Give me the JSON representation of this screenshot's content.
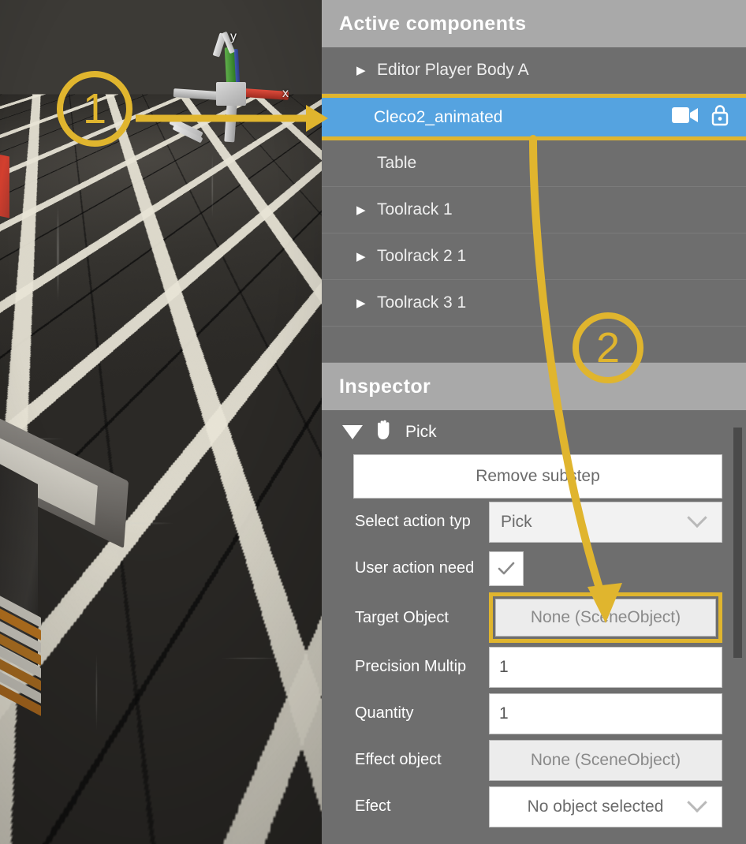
{
  "accent_color": "#e0b52e",
  "selection_color": "#55a3e0",
  "panel_bg": "#6e6e6e",
  "header_bg": "#a9a9a9",
  "viewport": {
    "name": "scene-viewport",
    "gizmo": {
      "x_label": "x",
      "y_label": "y"
    }
  },
  "hierarchy": {
    "title": "Active components",
    "rows": [
      {
        "label": "Editor Player Body A",
        "expandable": true,
        "selected": false,
        "icons": []
      },
      {
        "label": "Cleco2_animated",
        "expandable": false,
        "selected": true,
        "icons": [
          "camera-icon",
          "unlock-icon"
        ]
      },
      {
        "label": "Table",
        "expandable": false,
        "selected": false,
        "icons": []
      },
      {
        "label": "Toolrack 1",
        "expandable": true,
        "selected": false,
        "icons": []
      },
      {
        "label": "Toolrack 2 1",
        "expandable": true,
        "selected": false,
        "icons": []
      },
      {
        "label": "Toolrack 3 1",
        "expandable": true,
        "selected": false,
        "icons": []
      }
    ]
  },
  "inspector": {
    "title": "Inspector",
    "component": {
      "icon": "hand-icon",
      "name": "Pick",
      "expanded": true
    },
    "remove_button": "Remove substep",
    "fields": [
      {
        "label": "Select action typ",
        "type": "select",
        "value": "Pick",
        "highlighted": false
      },
      {
        "label": "User action need",
        "type": "checkbox",
        "value": "checked",
        "highlighted": false
      },
      {
        "label": "Target  Object",
        "type": "objfield",
        "value": "None (SceneObject)",
        "highlighted": true
      },
      {
        "label": "Precision  Multip",
        "type": "input",
        "value": "1",
        "highlighted": false
      },
      {
        "label": "Quantity",
        "type": "input",
        "value": "1",
        "highlighted": false
      },
      {
        "label": "Effect object",
        "type": "objfield",
        "value": "None (SceneObject)",
        "highlighted": false
      },
      {
        "label": "Efect",
        "type": "select",
        "value": "No object selected",
        "highlighted": false
      }
    ]
  },
  "annotations": [
    {
      "number": "1",
      "target": "selected hierarchy row Cleco2_animated"
    },
    {
      "number": "2",
      "target": "Target Object field"
    }
  ]
}
